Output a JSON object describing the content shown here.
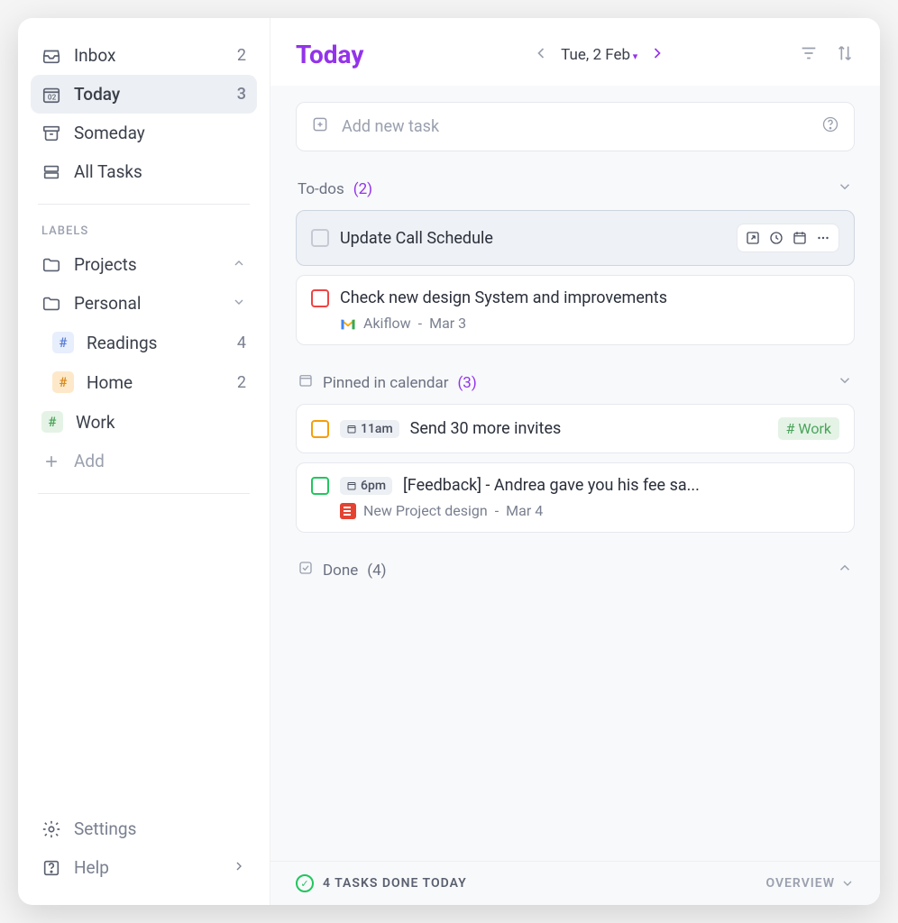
{
  "sidebar": {
    "nav": [
      {
        "key": "inbox",
        "label": "Inbox",
        "count": "2"
      },
      {
        "key": "today",
        "label": "Today",
        "count": "3"
      },
      {
        "key": "someday",
        "label": "Someday",
        "count": ""
      },
      {
        "key": "alltasks",
        "label": "All Tasks",
        "count": ""
      }
    ],
    "labels_header": "LABELS",
    "folders": [
      {
        "key": "projects",
        "label": "Projects"
      },
      {
        "key": "personal",
        "label": "Personal"
      }
    ],
    "sublabels": [
      {
        "key": "readings",
        "label": "Readings",
        "count": "4",
        "color_bg": "#e7eefc",
        "color_fg": "#5b7fd6"
      },
      {
        "key": "home",
        "label": "Home",
        "count": "2",
        "color_bg": "#fde9c9",
        "color_fg": "#d88a1e"
      }
    ],
    "work": {
      "label": "Work",
      "color_bg": "#e4f3e6",
      "color_fg": "#4aa35a",
      "hash": "#"
    },
    "add": "Add",
    "settings": "Settings",
    "help": "Help"
  },
  "header": {
    "title": "Today",
    "date": "Tue, 2 Feb"
  },
  "addTask": "Add new task",
  "sections": {
    "todos": {
      "label": "To-dos",
      "count": "(2)"
    },
    "pinned": {
      "label": "Pinned in calendar",
      "count": "(3)"
    },
    "done": {
      "label": "Done",
      "count": "(4)"
    }
  },
  "tasks": {
    "t1": {
      "title": "Update Call Schedule"
    },
    "t2": {
      "title": "Check new design System and improvements",
      "source": "Akiflow",
      "date": "Mar 3",
      "checkbox_color": "#ef4444"
    },
    "t3": {
      "time": "11am",
      "title": "Send 30 more invites",
      "checkbox_color": "#f59e0b",
      "label": "# Work",
      "label_bg": "#e4f3e6",
      "label_fg": "#4aa35a"
    },
    "t4": {
      "time": "6pm",
      "title": "[Feedback] - Andrea gave you his fee sa...",
      "checkbox_color": "#22c55e",
      "source": "New Project design",
      "date": "Mar 4"
    }
  },
  "footer": {
    "done": "4 TASKS DONE TODAY",
    "overview": "OVERVIEW"
  }
}
